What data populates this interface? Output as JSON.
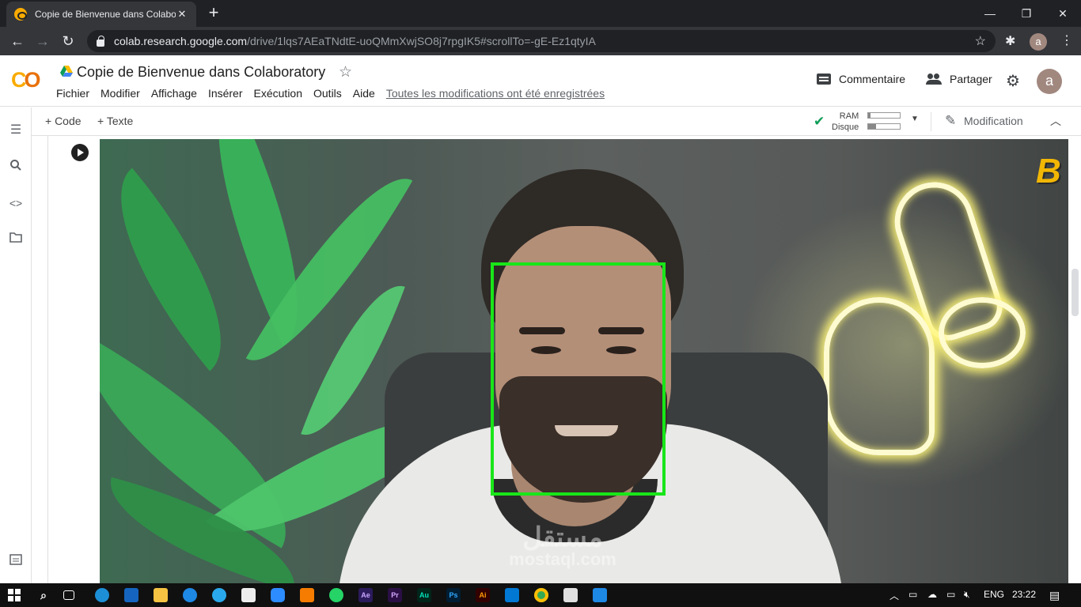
{
  "browser": {
    "tab_title": "Copie de Bienvenue dans Colaboratory",
    "tab_close": "✕",
    "new_tab": "+",
    "url_host": "colab.research.google.com",
    "url_path": "/drive/1lqs7AEaTNdtE-uoQMmXwjSO8j7rpgIK5#scrollTo=-gE-Ez1qtyIA",
    "profile_initial": "a",
    "icons": [
      "back-icon",
      "forward-icon",
      "reload-icon",
      "lock-icon",
      "bookmark-star-icon",
      "extensions-icon",
      "kebab-menu-icon"
    ]
  },
  "window_controls": {
    "minimize": "—",
    "restore": "❐",
    "close": "✕"
  },
  "colab": {
    "logo": "CO",
    "title": "Copie de Bienvenue dans Colaboratory",
    "menu": [
      "Fichier",
      "Modifier",
      "Affichage",
      "Insérer",
      "Exécution",
      "Outils",
      "Aide"
    ],
    "saved_status": "Toutes les modifications ont été enregistrées",
    "comment_label": "Commentaire",
    "share_label": "Partager",
    "user_initial": "a",
    "add_code": "+ Code",
    "add_text": "+ Texte",
    "ram_label": "RAM",
    "disk_label": "Disque",
    "ram_fraction": 0.08,
    "disk_fraction": 0.25,
    "edit_label": "Modification"
  },
  "cell": {
    "output_watermark_logo": "مستقل",
    "output_watermark_text": "mostaql.com",
    "brand_letter": "B",
    "face_box_color": "#19e619"
  },
  "taskbar": {
    "language": "ENG",
    "time": "23:22",
    "apps": [
      "windows-start",
      "search",
      "task-view",
      "edge",
      "mail",
      "file-explorer",
      "internet-explorer",
      "telegram",
      "store",
      "zoom",
      "vlc",
      "whatsapp",
      "after-effects",
      "premiere",
      "audition",
      "photoshop",
      "illustrator",
      "vscode",
      "chrome",
      "paint",
      "remote-desktop"
    ],
    "labels": {
      "after_effects": "Ae",
      "premiere": "Pr",
      "audition": "Au",
      "photoshop": "Ps",
      "illustrator": "Ai"
    }
  }
}
